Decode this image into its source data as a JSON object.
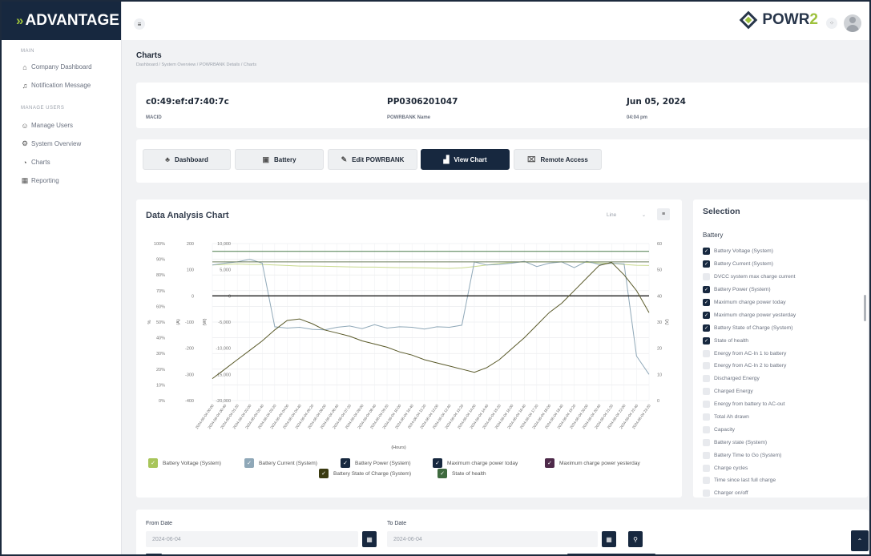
{
  "brand": {
    "name": "ADVANTAGE"
  },
  "logo": {
    "part1": "POWR",
    "part2": "2"
  },
  "sidebar": {
    "section_main": "MAIN",
    "section_manage": "MANAGE USERS",
    "items": [
      {
        "label": "Company Dashboard",
        "icon": "home-icon"
      },
      {
        "label": "Notification Message",
        "icon": "bell-icon"
      },
      {
        "label": "Manage Users",
        "icon": "users-icon"
      },
      {
        "label": "System Overview",
        "icon": "gear-icon"
      },
      {
        "label": "Charts",
        "icon": "chart-icon"
      },
      {
        "label": "Reporting",
        "icon": "grid-icon"
      }
    ]
  },
  "page": {
    "title": "Charts",
    "breadcrumb": "Dashboard  /  System Overview  /  POWRBANK Details  /  Charts"
  },
  "info": {
    "macid_value": "c0:49:ef:d7:40:7c",
    "macid_label": "MACID",
    "name_value": "PP0306201047",
    "name_label": "POWRBANK Name",
    "date_value": "Jun 05, 2024",
    "time_value": "04:04 pm"
  },
  "tabs": [
    {
      "label": "Dashboard",
      "icon": "sitemap-icon",
      "active": false
    },
    {
      "label": "Battery",
      "icon": "battery-icon",
      "active": false
    },
    {
      "label": "Edit POWRBANK",
      "icon": "edit-icon",
      "active": false
    },
    {
      "label": "View Chart",
      "icon": "chart-icon",
      "active": true
    },
    {
      "label": "Remote Access",
      "icon": "remote-icon",
      "active": false
    }
  ],
  "chart_card": {
    "title": "Data Analysis Chart",
    "type_select": "Line"
  },
  "chart_data": {
    "type": "line",
    "xlabel": "(Hours)",
    "x_ticks": [
      "2024-06-04 00:00",
      "2024-06-04 00:40",
      "2024-06-04 01:20",
      "2024-06-04 02:00",
      "2024-06-04 02:40",
      "2024-06-04 03:20",
      "2024-06-04 04:00",
      "2024-06-04 04:40",
      "2024-06-04 05:20",
      "2024-06-04 06:00",
      "2024-06-04 06:40",
      "2024-06-04 07:20",
      "2024-06-04 08:00",
      "2024-06-04 08:40",
      "2024-06-04 09:20",
      "2024-06-04 10:00",
      "2024-06-04 10:40",
      "2024-06-04 11:20",
      "2024-06-04 12:00",
      "2024-06-04 12:40",
      "2024-06-04 13:20",
      "2024-06-04 14:00",
      "2024-06-04 14:40",
      "2024-06-04 15:20",
      "2024-06-04 16:00",
      "2024-06-04 16:40",
      "2024-06-04 17:20",
      "2024-06-04 18:00",
      "2024-06-04 18:40",
      "2024-06-04 19:20",
      "2024-06-04 20:00",
      "2024-06-04 20:40",
      "2024-06-04 21:20",
      "2024-06-04 22:00",
      "2024-06-04 22:40",
      "2024-06-04 23:20"
    ],
    "axes": {
      "pct": {
        "label": "%",
        "ticks": [
          "100%",
          "90%",
          "80%",
          "70%",
          "60%",
          "50%",
          "40%",
          "30%",
          "20%",
          "10%",
          "0%"
        ],
        "range": [
          0,
          100
        ]
      },
      "amps": {
        "label": "(A)",
        "ticks": [
          "200",
          "100",
          "0",
          "-100",
          "-200",
          "-300",
          "-400"
        ],
        "range": [
          -400,
          200
        ]
      },
      "watts": {
        "label": "(W)",
        "ticks": [
          "10,000",
          "5,000",
          "0",
          "-5,000",
          "-10,000",
          "-15,000",
          "-20,000"
        ],
        "range": [
          -20000,
          10000
        ]
      },
      "volts": {
        "label": "(V)",
        "ticks": [
          "60",
          "50",
          "40",
          "30",
          "20",
          "10",
          "0"
        ],
        "range": [
          0,
          60
        ]
      }
    },
    "series": [
      {
        "name": "Battery Voltage (System)",
        "color": "#c8d98e",
        "axis": "volts",
        "values": [
          51.8,
          52,
          52.2,
          52,
          52,
          51.8,
          51.6,
          51.4,
          51.4,
          51.3,
          51.2,
          51.1,
          51,
          51,
          50.9,
          50.8,
          50.8,
          50.7,
          50.6,
          50.5,
          50.7,
          51.2,
          51.8,
          52.4,
          52.8,
          53,
          53,
          53,
          53,
          53,
          52.8,
          52.6,
          52.4,
          52,
          51.7,
          51.6
        ]
      },
      {
        "name": "Battery Current (System)",
        "color": "#8fa8b8",
        "axis": "amps",
        "values": [
          118,
          125,
          130,
          140,
          125,
          -118,
          -123,
          -120,
          -128,
          -130,
          -120,
          -115,
          -125,
          -110,
          -123,
          -118,
          -120,
          -127,
          -118,
          -120,
          -112,
          130,
          118,
          120,
          125,
          132,
          112,
          125,
          130,
          108,
          132,
          120,
          125,
          122,
          -230,
          -300
        ]
      },
      {
        "name": "Battery Power (System)",
        "color": "#1a1a1a",
        "axis": "watts",
        "values": [
          0,
          0,
          0,
          0,
          0,
          0,
          0,
          0,
          0,
          0,
          0,
          0,
          0,
          0,
          0,
          0,
          0,
          0,
          0,
          0,
          0,
          0,
          0,
          0,
          0,
          0,
          0,
          0,
          0,
          0,
          0,
          0,
          0,
          0,
          0,
          0
        ]
      },
      {
        "name": "Maximum charge power today",
        "color": "#6b7d5a",
        "axis": "watts",
        "values": [
          6500,
          6500,
          6500,
          6500,
          6500,
          6500,
          6500,
          6500,
          6500,
          6500,
          6500,
          6500,
          6500,
          6500,
          6500,
          6500,
          6500,
          6500,
          6500,
          6500,
          6500,
          6500,
          6500,
          6500,
          6500,
          6500,
          6500,
          6500,
          6500,
          6500,
          6500,
          6500,
          6500,
          6500,
          6500,
          6500
        ]
      },
      {
        "name": "Maximum charge power yesterday",
        "color": "#4e2a4a",
        "axis": "watts",
        "values": []
      },
      {
        "name": "Battery State of Charge (System)",
        "color": "#5a5a2a",
        "axis": "pct",
        "values": [
          14,
          20,
          26,
          32,
          38,
          45,
          51,
          52,
          49,
          45,
          43,
          41,
          38,
          36,
          34,
          31,
          29,
          26,
          24,
          22,
          20,
          18,
          21,
          26,
          33,
          40,
          48,
          56,
          62,
          70,
          78,
          86,
          88,
          80,
          70,
          56
        ]
      },
      {
        "name": "State of health",
        "color": "#4a7a4a",
        "axis": "pct",
        "values": [
          95,
          95,
          95,
          95,
          95,
          95,
          95,
          95,
          95,
          95,
          95,
          95,
          95,
          95,
          95,
          95,
          95,
          95,
          95,
          95,
          95,
          95,
          95,
          95,
          95,
          95,
          95,
          95,
          95,
          95,
          95,
          95,
          95,
          95,
          95,
          95
        ]
      }
    ]
  },
  "legend": [
    {
      "label": "Battery Voltage (System)",
      "color": "#a8c55a"
    },
    {
      "label": "Battery Current (System)",
      "color": "#8fa8b8"
    },
    {
      "label": "Battery Power (System)",
      "color": "#17283f"
    },
    {
      "label": "Maximum charge power today",
      "color": "#17283f"
    },
    {
      "label": "Maximum charge power yesterday",
      "color": "#4e2a4a"
    },
    {
      "label": "Battery State of Charge (System)",
      "color": "#3a3a10"
    },
    {
      "label": "State of health",
      "color": "#3e6a3e"
    }
  ],
  "selection": {
    "title": "Selection",
    "group": "Battery",
    "items": [
      {
        "label": "Battery Voltage (System)",
        "checked": true
      },
      {
        "label": "Battery Current (System)",
        "checked": true
      },
      {
        "label": "DVCC system max charge current",
        "checked": false
      },
      {
        "label": "Battery Power (System)",
        "checked": true
      },
      {
        "label": "Maximum charge power today",
        "checked": true
      },
      {
        "label": "Maximum charge power yesterday",
        "checked": true
      },
      {
        "label": "Battery State of Charge (System)",
        "checked": true
      },
      {
        "label": "State of health",
        "checked": true
      },
      {
        "label": "Energy from AC-In 1 to battery",
        "checked": false
      },
      {
        "label": "Energy from AC-In 2 to battery",
        "checked": false
      },
      {
        "label": "Discharged Energy",
        "checked": false
      },
      {
        "label": "Charged Energy",
        "checked": false
      },
      {
        "label": "Energy from battery to AC-out",
        "checked": false
      },
      {
        "label": "Total Ah drawn",
        "checked": false
      },
      {
        "label": "Capacity",
        "checked": false
      },
      {
        "label": "Battery state (System)",
        "checked": false
      },
      {
        "label": "Battery Time to Go (System)",
        "checked": false
      },
      {
        "label": "Charge cycles",
        "checked": false
      },
      {
        "label": "Time since last full charge",
        "checked": false
      },
      {
        "label": "Charger on/off",
        "checked": false
      }
    ]
  },
  "dates": {
    "from_label": "From Date",
    "from_value": "2024-06-04",
    "to_label": "To Date",
    "to_value": "2024-06-04"
  }
}
